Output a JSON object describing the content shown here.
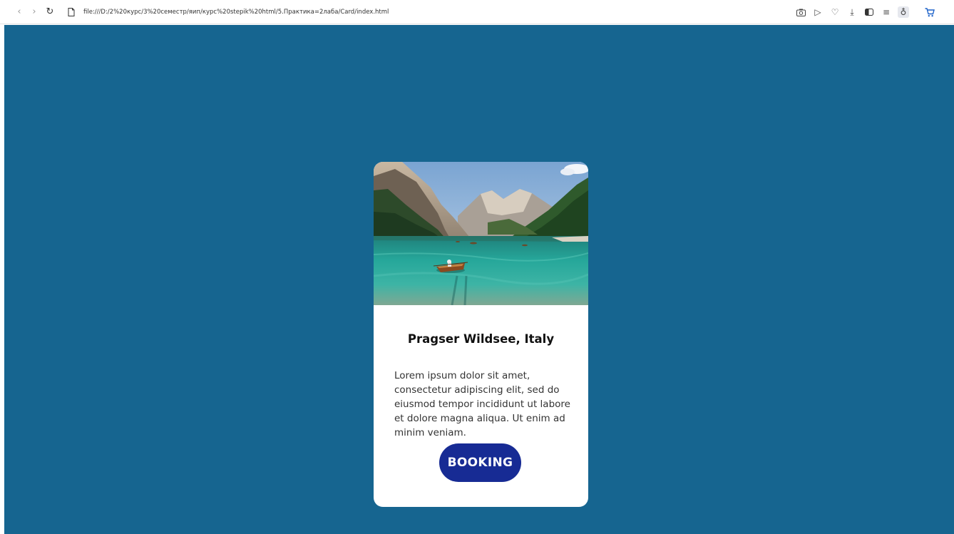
{
  "browser": {
    "url": "file:///D:/2%20курс/3%20семестр/яип/курс%20stepik%20html/5.Практика=2лаба/Card/index.html",
    "icons": [
      "back-icon",
      "forward-icon",
      "reload-icon",
      "file-icon",
      "screenshot-icon",
      "send-icon",
      "heart-icon",
      "download-icon",
      "sidebar-icon",
      "menu-icon",
      "profile-icon",
      "cart-icon"
    ]
  },
  "page": {
    "background_color": "#166590"
  },
  "card": {
    "image_description": "mountain lake with rowing boat",
    "title": "Pragser Wildsee, Italy",
    "text": "Lorem ipsum dolor sit amet, consectetur adipiscing elit, sed do eiusmod tempor incididunt ut labore et dolore magna aliqua. Ut enim ad minim veniam.",
    "button_label": "BOOKING",
    "button_color": "#172b94"
  }
}
